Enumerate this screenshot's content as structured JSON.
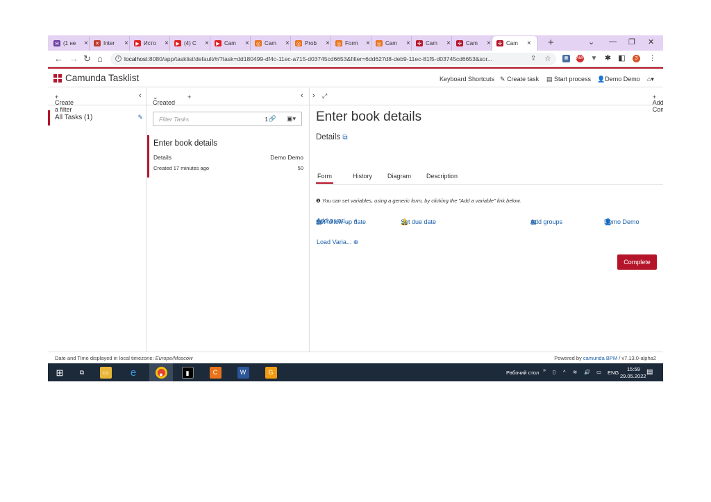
{
  "browser": {
    "tabs": [
      {
        "label": "(1 не",
        "color": "#6b3fa0"
      },
      {
        "label": "Inter",
        "color": "#c0392b"
      },
      {
        "label": "Исто",
        "color": "#e02020"
      },
      {
        "label": "(4) C",
        "color": "#e02020"
      },
      {
        "label": "Cam",
        "color": "#e02020"
      },
      {
        "label": "Cam",
        "color": "#e8731a"
      },
      {
        "label": "Prob",
        "color": "#e8731a"
      },
      {
        "label": "Form",
        "color": "#e8731a"
      },
      {
        "label": "Cam",
        "color": "#e8731a"
      },
      {
        "label": "Cam",
        "color": "#b5152b"
      },
      {
        "label": "Cam",
        "color": "#b5152b"
      },
      {
        "label": "Cam",
        "color": "#b5152b"
      }
    ],
    "new_tab": "+",
    "url_host": "localhost",
    "url_rest": ":8080/app/tasklist/default/#/?task=dd180499-df4c-11ec-a715-d03745cd6653&filter=6dd627d8-deb9-11ec-81f5-d03745cd6653&sor...",
    "profile_initial": "З"
  },
  "app": {
    "brand": "Camunda Tasklist",
    "nav": {
      "shortcuts": "Keyboard Shortcuts",
      "create_task": "Create task",
      "start_process": "Start process",
      "user": "Demo Demo"
    }
  },
  "filters": {
    "header": "Create a filter",
    "items": [
      {
        "label": "All Tasks (1)"
      }
    ]
  },
  "list": {
    "sort_label": "Created",
    "search_placeholder": "Filter Tasks",
    "count": "1",
    "task": {
      "name": "Enter book details",
      "process": "Details",
      "assignee": "Demo Demo",
      "created": "Created 17 minutes ago",
      "priority": "50"
    }
  },
  "detail": {
    "add_comment": "Add Comment",
    "title": "Enter book details",
    "process_link": "Details",
    "actions": {
      "follow_up": "Set follow-up date",
      "due": "Set due date",
      "groups": "Add groups",
      "assignee": "Demo Demo"
    },
    "tabs": [
      "Form",
      "History",
      "Diagram",
      "Description"
    ],
    "hint": "You can set variables, using a generic form, by clicking the \"Add a variable\" link below.",
    "add_variable": "Add a vari...",
    "load_variables": "Load Varia...",
    "complete": "Complete"
  },
  "footer": {
    "left_prefix": "Date and Time displayed in local timezone:",
    "timezone": "Europe/Moscow",
    "powered_prefix": "Powered by",
    "powered_link": "camunda BPM",
    "version": "/ v7.13.0-alpha2"
  },
  "taskbar": {
    "desktop_label": "Рабочий стол",
    "lang": "ENG",
    "time": "15:59",
    "date": "29.05.2022"
  }
}
